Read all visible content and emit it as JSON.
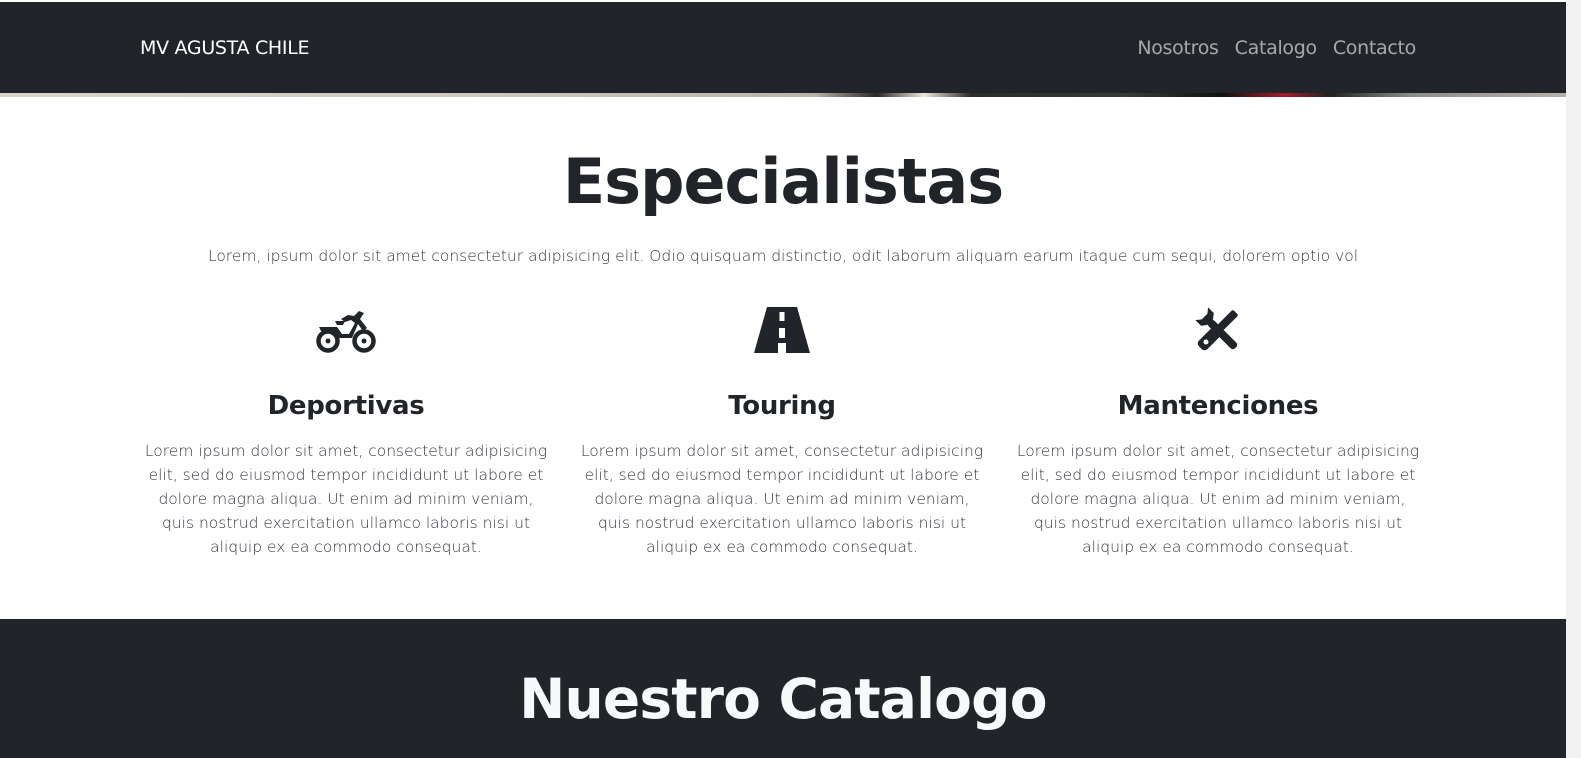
{
  "navbar": {
    "brand": "MV AGUSTA CHILE",
    "links": [
      "Nosotros",
      "Catalogo",
      "Contacto"
    ]
  },
  "specialists": {
    "title": "Especialistas",
    "lead": "Lorem, ipsum dolor sit amet consectetur adipisicing elit. Odio quisquam distinctio, odit laborum aliquam earum itaque cum sequi, dolorem optio vol",
    "features": [
      {
        "icon": "motorcycle-icon",
        "title": "Deportivas",
        "text": "Lorem ipsum dolor sit amet, consectetur adipisicing elit, sed do eiusmod tempor incididunt ut labore et dolore magna aliqua. Ut enim ad minim veniam, quis nostrud exercitation ullamco laboris nisi ut aliquip ex ea commodo consequat."
      },
      {
        "icon": "road-icon",
        "title": "Touring",
        "text": "Lorem ipsum dolor sit amet, consectetur adipisicing elit, sed do eiusmod tempor incididunt ut labore et dolore magna aliqua. Ut enim ad minim veniam, quis nostrud exercitation ullamco laboris nisi ut aliquip ex ea commodo consequat."
      },
      {
        "icon": "tools-icon",
        "title": "Mantenciones",
        "text": "Lorem ipsum dolor sit amet, consectetur adipisicing elit, sed do eiusmod tempor incididunt ut labore et dolore magna aliqua. Ut enim ad minim veniam, quis nostrud exercitation ullamco laboris nisi ut aliquip ex ea commodo consequat."
      }
    ]
  },
  "catalog": {
    "title": "Nuestro Catalogo"
  },
  "colors": {
    "dark": "#212529",
    "text": "#212529",
    "nav_link": "rgba(255,255,255,0.6)"
  }
}
